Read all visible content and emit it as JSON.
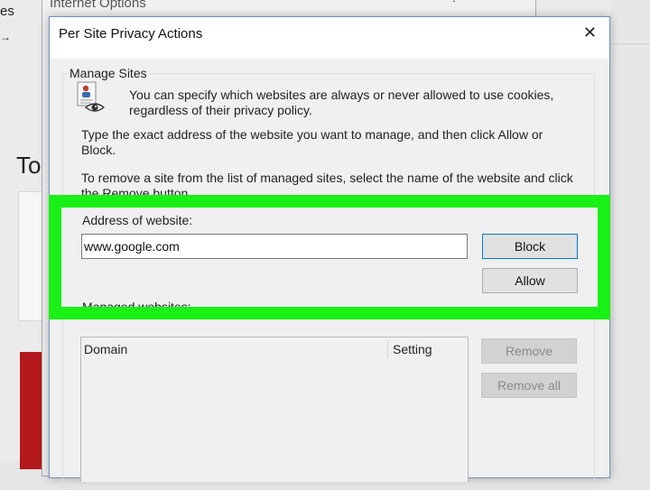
{
  "background": {
    "fragment_es": "es",
    "fragment_to": "To",
    "fragment_arrow": "→",
    "internet_options_title": "Internet Options",
    "help_glyph": "?",
    "close_glyph": "✕"
  },
  "dialog": {
    "title": "Per Site Privacy Actions",
    "close_glyph": "✕",
    "group_label": "Manage Sites",
    "info_text_1": "You can specify which websites are always or never allowed to use cookies, regardless of their privacy policy.",
    "info_text_2": "Type the exact address of the website you want to manage, and then click Allow or Block.",
    "info_text_3": "To remove a site from the list of managed sites, select the name of the website and click the Remove button.",
    "address_label": "Address of website:",
    "address_value": "www.google.com",
    "block_label": "Block",
    "allow_label": "Allow",
    "managed_label": "Managed websites:",
    "columns": {
      "domain": "Domain",
      "setting": "Setting"
    },
    "remove_label": "Remove",
    "remove_all_label": "Remove all"
  },
  "icons": {
    "privacy": "privacy-document-eye-icon",
    "close": "close-icon"
  },
  "colors": {
    "highlight": "#19f016",
    "background_red": "#b3191c",
    "dialog_border": "#6f8fbf"
  }
}
